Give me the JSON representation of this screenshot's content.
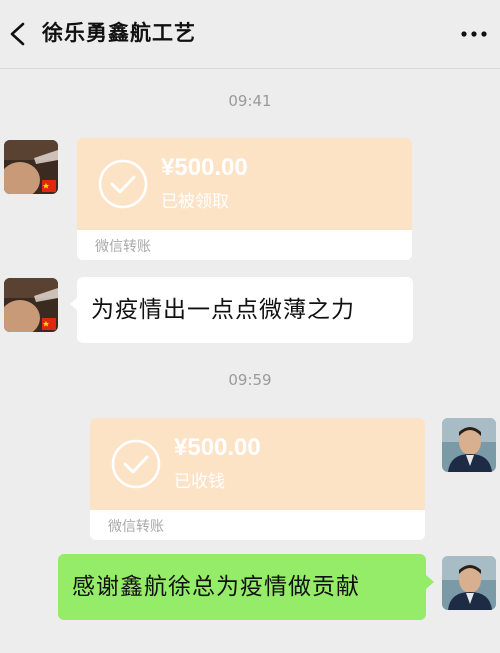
{
  "header": {
    "title": "徐乐勇鑫航工艺"
  },
  "messages": {
    "time1": "09:41",
    "transfer1": {
      "amount": "¥500.00",
      "status": "已被领取",
      "footer": "微信转账"
    },
    "text1": "为疫情出一点点微薄之力",
    "time2": "09:59",
    "transfer2": {
      "amount": "¥500.00",
      "status": "已收钱",
      "footer": "微信转账"
    },
    "text2": "感谢鑫航徐总为疫情做贡献"
  },
  "colors": {
    "background": "#ededed",
    "transfer_bg": "#fde3c6",
    "sent_bubble": "#95ec69",
    "received_bubble": "#ffffff"
  },
  "icons": [
    "back-arrow-icon",
    "more-dots-icon",
    "check-circle-icon",
    "china-flag-icon"
  ]
}
